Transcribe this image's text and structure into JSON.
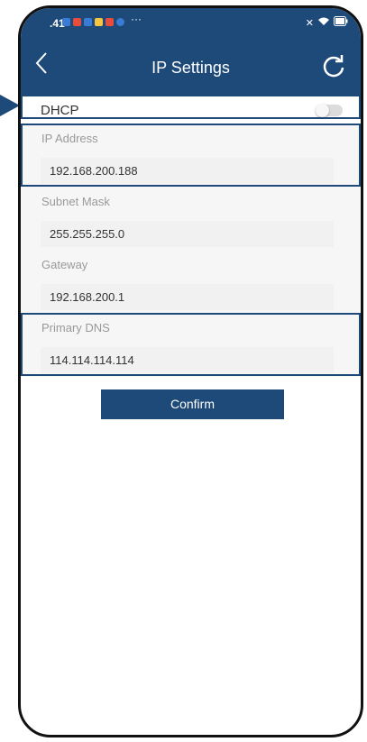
{
  "statusbar": {
    "time": ".41",
    "more": "···"
  },
  "header": {
    "title": "IP Settings"
  },
  "dhcp": {
    "label": "DHCP",
    "enabled": false
  },
  "fields": [
    {
      "label": "IP Address",
      "value": "192.168.200.188"
    },
    {
      "label": "Subnet Mask",
      "value": "255.255.255.0"
    },
    {
      "label": "Gateway",
      "value": "192.168.200.1"
    },
    {
      "label": "Primary DNS",
      "value": "114.114.114.114"
    }
  ],
  "confirm_label": "Confirm",
  "colors": {
    "primary": "#1e4a7a",
    "notif_red": "#e74c3c",
    "notif_blue": "#3a7bd5",
    "notif_yellow": "#f4c542"
  }
}
